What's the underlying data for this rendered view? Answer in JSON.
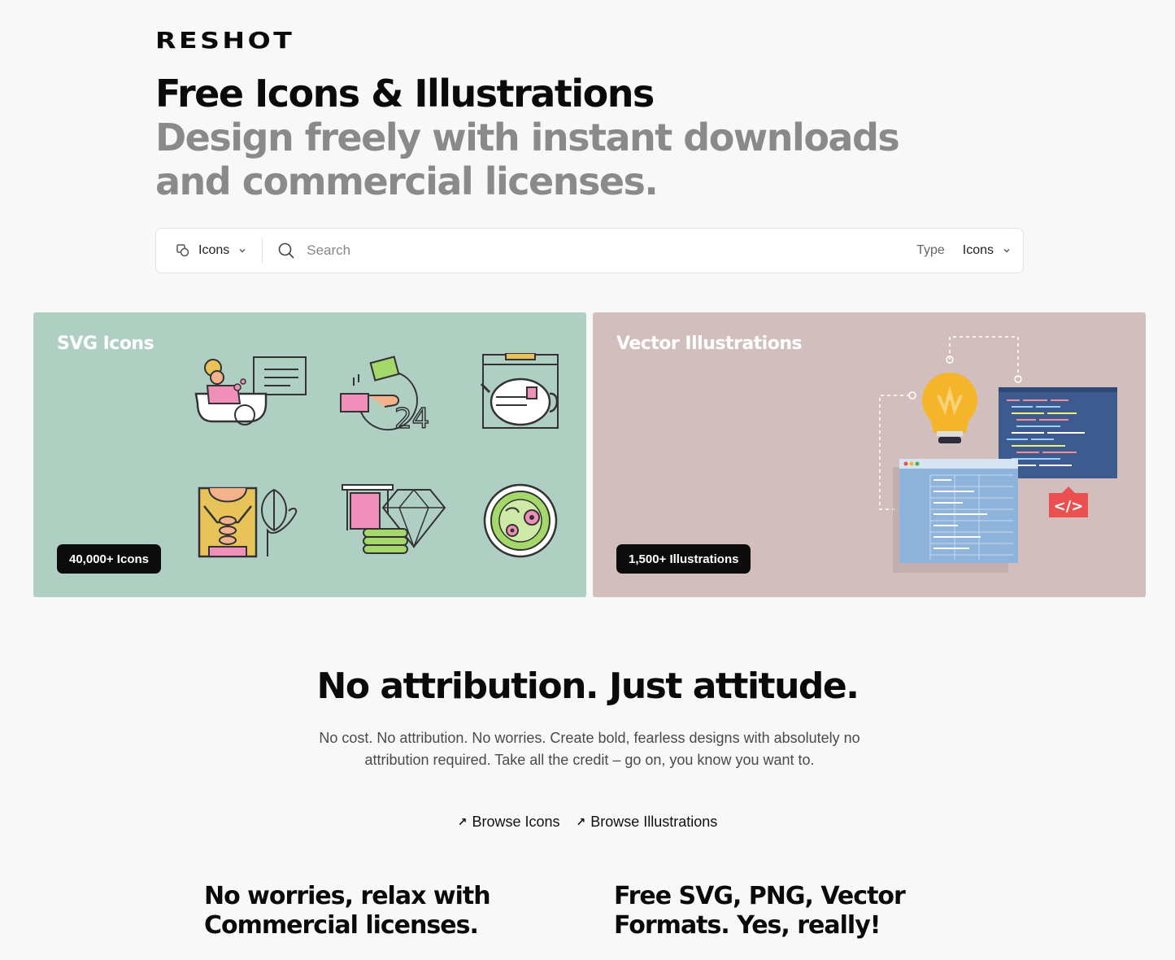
{
  "brand": {
    "logo": "RESHOT"
  },
  "hero": {
    "title": "Free Icons & Illustrations",
    "subtitle": "Design freely with instant downloads and commercial licenses."
  },
  "search": {
    "type_selector": "Icons",
    "placeholder": "Search",
    "filter_label": "Type",
    "filter_value": "Icons"
  },
  "cards": {
    "icons": {
      "title": "SVG Icons",
      "badge": "40,000+ Icons",
      "bg": "#afcfc2"
    },
    "illustrations": {
      "title": "Vector Illustrations",
      "badge": "1,500+ Illustrations",
      "bg": "#d3bebe"
    }
  },
  "icon_samples": [
    "bath-icon",
    "hand-wash-24-icon",
    "teapot-icon",
    "massage-icon",
    "gem-towel-icon",
    "salad-bowl-icon"
  ],
  "attribution": {
    "title": "No attribution. Just attitude.",
    "text": "No cost. No attribution. No worries. Create bold, fearless designs with absolutely no attribution required. Take all the credit – go on, you know you want to.",
    "links": [
      "Browse Icons",
      "Browse Illustrations"
    ]
  },
  "features": [
    {
      "title": "No worries, relax with Commercial licenses."
    },
    {
      "title": "Free SVG, PNG, Vector Formats. Yes, really!"
    }
  ],
  "colors": {
    "accent_code": "#e9504f",
    "code_window": "#3e5b8f",
    "bulb": "#f5b52a"
  }
}
